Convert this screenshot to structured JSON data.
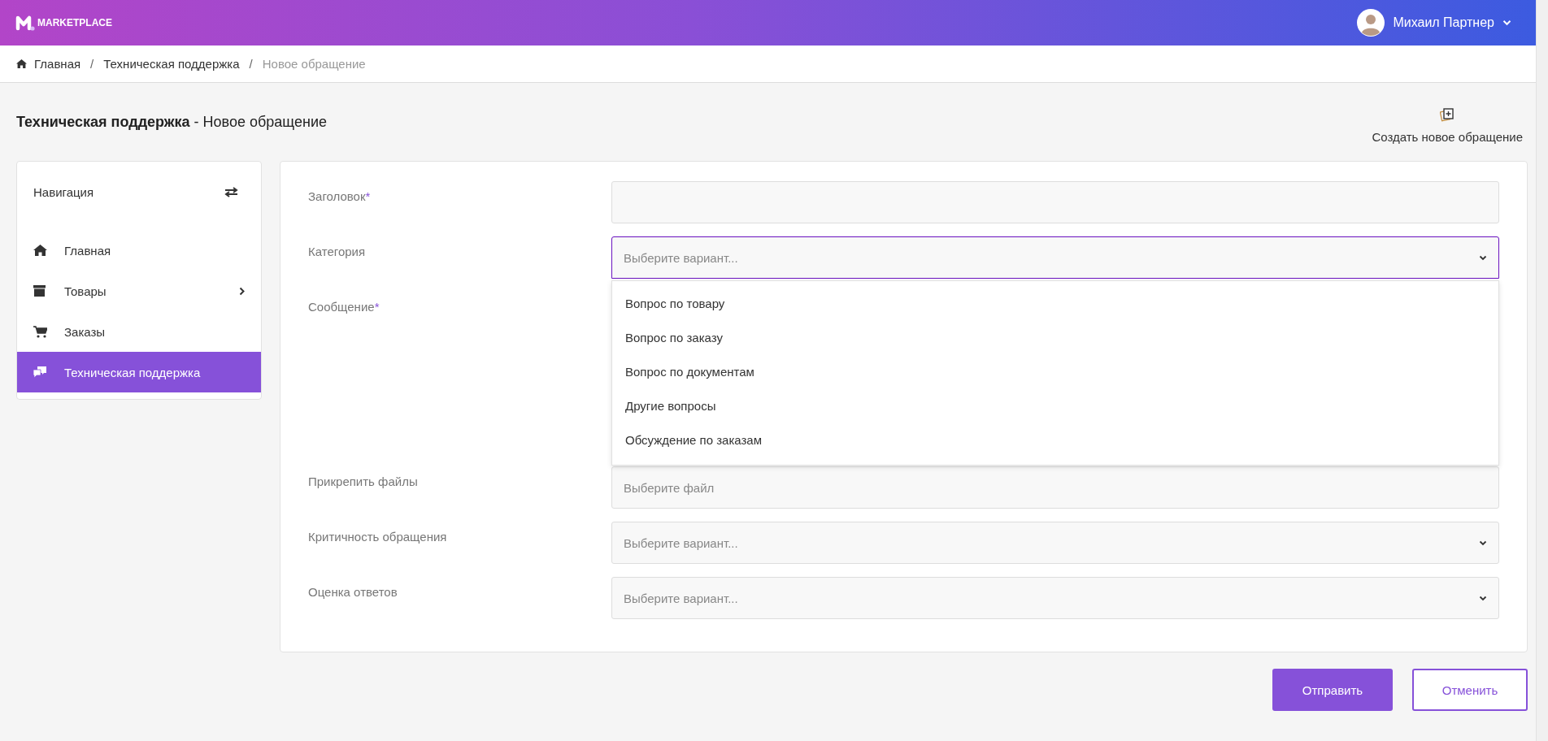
{
  "header": {
    "logo_text": "MARKETPLACE",
    "user_name": "Михаил Партнер"
  },
  "breadcrumb": [
    {
      "label": "Главная",
      "kind": "home",
      "current": false
    },
    {
      "label": "Техническая поддержка",
      "kind": "link",
      "current": false
    },
    {
      "label": "Новое обращение",
      "kind": "link",
      "current": true
    }
  ],
  "breadcrumb_separator": "/",
  "page_title": "**Техническая поддержка** - Новое обращение",
  "create_button": {
    "label": "Создать новое обращение"
  },
  "navigation": {
    "title": "Навигация",
    "items": [
      {
        "label": "Главная",
        "kind": "home",
        "has_submenu": false,
        "selected": false
      },
      {
        "label": "Товары",
        "kind": "catalog",
        "has_submenu": true,
        "selected": false
      },
      {
        "label": "Заказы",
        "kind": "orders",
        "has_submenu": false,
        "selected": false
      },
      {
        "label": "Техническая поддержка",
        "kind": "support",
        "has_submenu": false,
        "selected": true
      }
    ]
  },
  "form": {
    "fields": [
      {
        "label": "Заголовок",
        "required_mark": "*",
        "kind": "text"
      },
      {
        "label": "Категория",
        "kind": "select",
        "placeholder": "Выберите вариант...",
        "expanded": true,
        "options": [
          "Вопрос по товару",
          "Вопрос по заказу",
          "Вопрос по документам",
          "Другие вопросы",
          "Обсуждение по заказам"
        ]
      },
      {
        "label": "Сообщение",
        "required_mark": "*",
        "kind": "textarea"
      },
      {
        "label": "Прикрепить файлы",
        "kind": "file",
        "placeholder": "Выберите файл"
      },
      {
        "label": "Критичность обращения",
        "kind": "select",
        "placeholder": "Выберите вариант...",
        "expanded": false
      },
      {
        "label": "Оценка ответов",
        "kind": "select",
        "placeholder": "Выберите вариант...",
        "expanded": false
      }
    ]
  },
  "buttons": [
    {
      "label": "Отправить",
      "kind": "primary"
    },
    {
      "label": "Отменить",
      "kind": "secondary"
    }
  ]
}
